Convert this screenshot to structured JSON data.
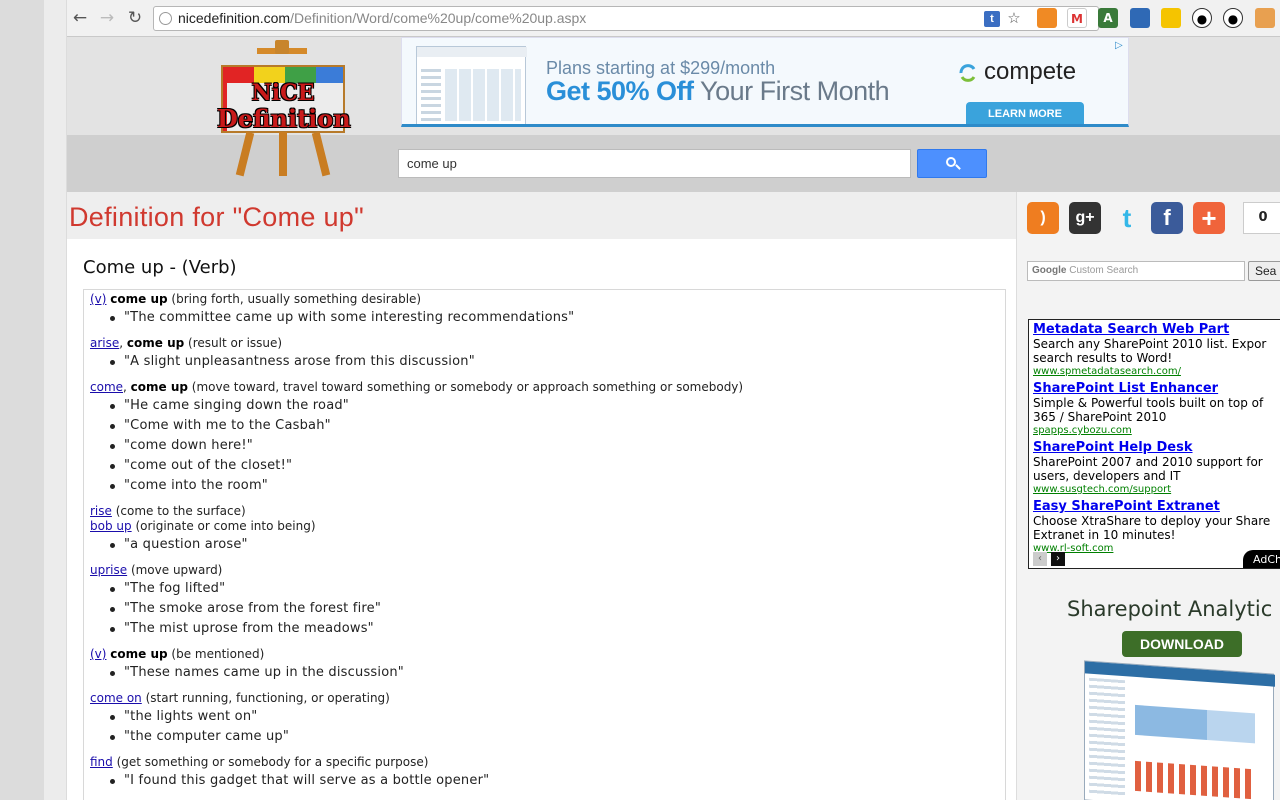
{
  "browser": {
    "url_host": "nicedefinition.com",
    "url_path": "/Definition/Word/come%20up/come%20up.aspx",
    "nav": {
      "back_icon": "←",
      "forward_icon": "→",
      "reload_icon": "↻"
    },
    "omni_icons": {
      "extension": "t",
      "bookmark": "☆"
    }
  },
  "site": {
    "logo_line1": "NiCE",
    "logo_line2": "Definition",
    "search_value": "come up"
  },
  "banner_ad": {
    "line1": "Plans starting at $299/month",
    "highlight": "Get 50% Off",
    "rest": " Your First Month",
    "brand": "compete",
    "cta": "LEARN MORE"
  },
  "page": {
    "title": "Definition for \"Come up\"",
    "section": "Come up - (Verb)"
  },
  "senses": [
    {
      "links": [
        "(v)"
      ],
      "headword": "come up",
      "gloss": " (bring forth, usually something desirable)",
      "examples": [
        "\"The committee came up with some interesting recommendations\""
      ]
    },
    {
      "links": [
        "arise"
      ],
      "headword": "come up",
      "gloss": " (result or issue)",
      "examples": [
        "\"A slight unpleasantness arose from this discussion\""
      ]
    },
    {
      "links": [
        "come"
      ],
      "headword": "come up",
      "gloss": " (move toward, travel toward something or somebody or approach something or somebody)",
      "examples": [
        "\"He came singing down the road\"",
        "\"Come with me to the Casbah\"",
        "\"come down here!\"",
        "\"come out of the closet!\"",
        "\"come into the room\""
      ]
    },
    {
      "lines": [
        {
          "link": "rise",
          "gloss": " (come to the surface)"
        },
        {
          "link": "bob up",
          "gloss": " (originate or come into being)"
        }
      ],
      "examples": [
        "\"a question arose\""
      ]
    },
    {
      "links": [
        "uprise"
      ],
      "headword": "",
      "gloss": " (move upward)",
      "examples": [
        "\"The fog lifted\"",
        "\"The smoke arose from the forest fire\"",
        "\"The mist uprose from the meadows\""
      ]
    },
    {
      "links": [
        "(v)"
      ],
      "headword": "come up",
      "gloss": " (be mentioned)",
      "examples": [
        "\"These names came up in the discussion\""
      ]
    },
    {
      "links": [
        "come on"
      ],
      "headword": "",
      "gloss": " (start running, functioning, or operating)",
      "examples": [
        "\"the lights went on\"",
        "\"the computer came up\""
      ]
    },
    {
      "links": [
        "find"
      ],
      "headword": "",
      "gloss": " (get something or somebody for a specific purpose)",
      "examples": [
        "\"I found this gadget that will serve as a bottle opener\""
      ]
    }
  ],
  "sidebar": {
    "share_count": "0",
    "custom_search_google": "Google",
    "custom_search_placeholder": " Custom Search",
    "search_button": "Sea",
    "ads": [
      {
        "title": "Metadata Search Web Part",
        "desc1": "Search any SharePoint 2010 list. Expor",
        "desc2": "search results to Word!",
        "url": "www.spmetadatasearch.com/"
      },
      {
        "title": "SharePoint List Enhancer",
        "desc1": "Simple & Powerful tools built on top of",
        "desc2": "365 / SharePoint 2010",
        "url": "spapps.cybozu.com"
      },
      {
        "title": "SharePoint Help Desk",
        "desc1": "SharePoint 2007 and 2010 support for",
        "desc2": "users, developers and IT",
        "url": "www.susgtech.com/support"
      },
      {
        "title": "Easy SharePoint Extranet",
        "desc1": "Choose XtraShare to deploy your Share",
        "desc2": "Extranet in 10 minutes!",
        "url": "www.rl-soft.com"
      }
    ],
    "adchoices_label": "AdCh",
    "promo_title": "Sharepoint Analytic",
    "promo_button": "DOWNLOAD"
  },
  "colors": {
    "title_red": "#d0392f",
    "link_blue": "#1a0dab",
    "search_blue": "#4d90fe"
  }
}
